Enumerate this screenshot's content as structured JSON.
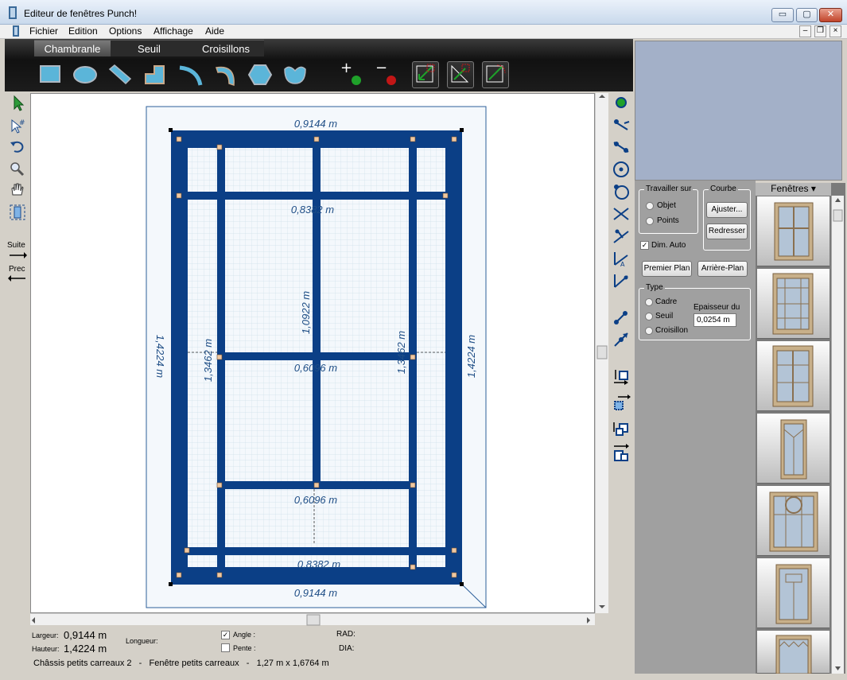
{
  "window": {
    "title": "Editeur de fenêtres Punch!",
    "minimize": "▭",
    "maximize": "▢",
    "close": "✕"
  },
  "menu": {
    "items": [
      "Fichier",
      "Edition",
      "Options",
      "Affichage",
      "Aide"
    ],
    "mdi_min": "–",
    "mdi_restore": "❐",
    "mdi_close": "×"
  },
  "tabs": [
    "Chambranle",
    "Seuil",
    "Croisillons"
  ],
  "left_tools": {
    "suite": "Suite",
    "prec": "Prec"
  },
  "dimensions": {
    "top_outer": "0,9144 m",
    "top_inner": "0,8382 m",
    "center_vertical": "1,0922 m",
    "left_outer": "1,4224 m",
    "right_outer": "1,4224 m",
    "left_inner": "1,3462 m",
    "right_inner": "1,3462 m",
    "middle_upper": "0,6096 m",
    "middle_lower": "0,6096 m",
    "bottom_inner": "0,8382 m",
    "bottom_outer": "0,9144 m"
  },
  "props": {
    "travailler_sur": "Travailler sur",
    "objet": "Objet",
    "points": "Points",
    "courbe": "Courbe",
    "ajuster": "Ajuster...",
    "redresser": "Redresser",
    "dim_auto": "Dim. Auto",
    "premier_plan": "Premier Plan",
    "arriere_plan": "Arrière-Plan",
    "type": "Type",
    "cadre": "Cadre",
    "seuil": "Seuil",
    "croisillon": "Croisillon",
    "epaisseur": "Epaisseur du",
    "epaisseur_value": "0,0254 m"
  },
  "gallery": {
    "title": "Fenêtres"
  },
  "status": {
    "largeur_label": "Largeur:",
    "largeur_value": "0,9144 m",
    "hauteur_label": "Hauteur:",
    "hauteur_value": "1,4224 m",
    "longueur_label": "Longueur:",
    "angle_label": "Angle :",
    "pente_label": "Pente :",
    "rad_label": "RAD:",
    "dia_label": "DIA:",
    "summary": "Châssis petits carreaux 2   -   Fenêtre petits carreaux   -   1,27 m x 1,6764 m"
  },
  "colors": {
    "frame": "#0b3f86",
    "dim_text": "#1f4e86",
    "grid": "#cfe1ea"
  }
}
